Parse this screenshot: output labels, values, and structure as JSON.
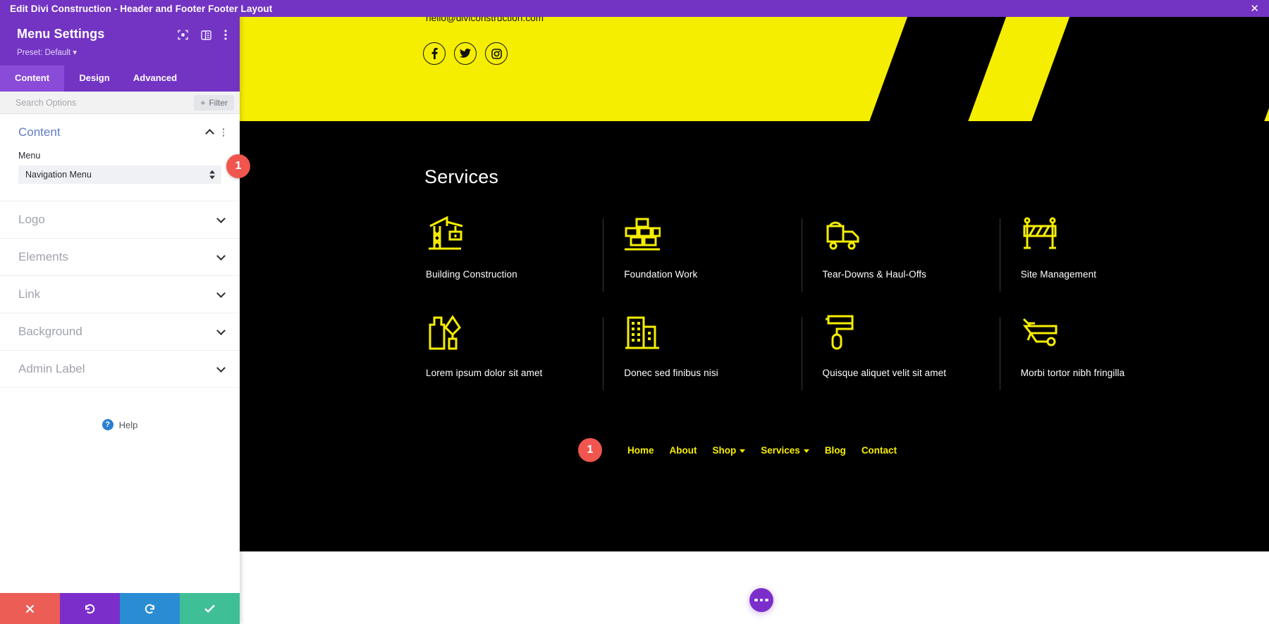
{
  "titlebar": {
    "title": "Edit Divi Construction - Header and Footer Footer Layout",
    "close_label": "✕"
  },
  "panel": {
    "title": "Menu Settings",
    "preset": "Preset: Default ▾",
    "head_icons": [
      {
        "name": "focus-icon"
      },
      {
        "name": "panel-layout-icon"
      },
      {
        "name": "kebab-menu-icon"
      }
    ],
    "tabs": [
      {
        "label": "Content",
        "active": true
      },
      {
        "label": "Design",
        "active": false
      },
      {
        "label": "Advanced",
        "active": false
      }
    ],
    "search": {
      "placeholder": "Search Options",
      "value": ""
    },
    "filter_label": "Filter",
    "sections": [
      {
        "label": "Content",
        "open": true
      },
      {
        "label": "Logo",
        "open": false
      },
      {
        "label": "Elements",
        "open": false
      },
      {
        "label": "Link",
        "open": false
      },
      {
        "label": "Background",
        "open": false
      },
      {
        "label": "Admin Label",
        "open": false
      }
    ],
    "content_section": {
      "field_label": "Menu",
      "select_value": "Navigation Menu"
    },
    "menu_badge": "1",
    "help_label": "Help",
    "help_icon_glyph": "?",
    "actions": [
      {
        "name": "cancel-button",
        "glyph": "✕"
      },
      {
        "name": "undo-button",
        "glyph": "↺"
      },
      {
        "name": "redo-button",
        "glyph": "↻"
      },
      {
        "name": "save-button",
        "glyph": "✓"
      }
    ]
  },
  "preview": {
    "contact_email": "hello@diviconstruction.com",
    "social_links": [
      {
        "name": "facebook-icon",
        "label": "Facebook"
      },
      {
        "name": "twitter-icon",
        "label": "Twitter"
      },
      {
        "name": "instagram-icon",
        "label": "Instagram"
      }
    ],
    "services_heading": "Services",
    "services": [
      {
        "label": "Building Construction",
        "icon": "crane-icon"
      },
      {
        "label": "Foundation Work",
        "icon": "brick-wall-icon"
      },
      {
        "label": "Tear-Downs & Haul-Offs",
        "icon": "dump-truck-icon"
      },
      {
        "label": "Site Management",
        "icon": "road-barrier-icon"
      },
      {
        "label": "Lorem ipsum dolor sit amet",
        "icon": "paint-tools-icon"
      },
      {
        "label": "Donec sed finibus nisi",
        "icon": "buildings-icon"
      },
      {
        "label": "Quisque aliquet velit sit amet",
        "icon": "paint-roller-icon"
      },
      {
        "label": "Morbi tortor nibh fringilla",
        "icon": "wheelbarrow-icon"
      }
    ],
    "footer_nav_badge": "1",
    "footer_nav": [
      {
        "label": "Home",
        "has_dropdown": false
      },
      {
        "label": "About",
        "has_dropdown": false
      },
      {
        "label": "Shop",
        "has_dropdown": true
      },
      {
        "label": "Services",
        "has_dropdown": true
      },
      {
        "label": "Blog",
        "has_dropdown": false
      },
      {
        "label": "Contact",
        "has_dropdown": false
      }
    ]
  },
  "colors": {
    "brand_purple": "#7334c4",
    "tab_active": "#8a4cd8",
    "accent_yellow": "#f6ee00",
    "badge_red": "#f0554e",
    "section_black": "#000000",
    "cancel_red": "#eb5d55",
    "undo_purple": "#7c2ecb",
    "redo_blue": "#2a8dd4",
    "save_green": "#3fbf96"
  }
}
